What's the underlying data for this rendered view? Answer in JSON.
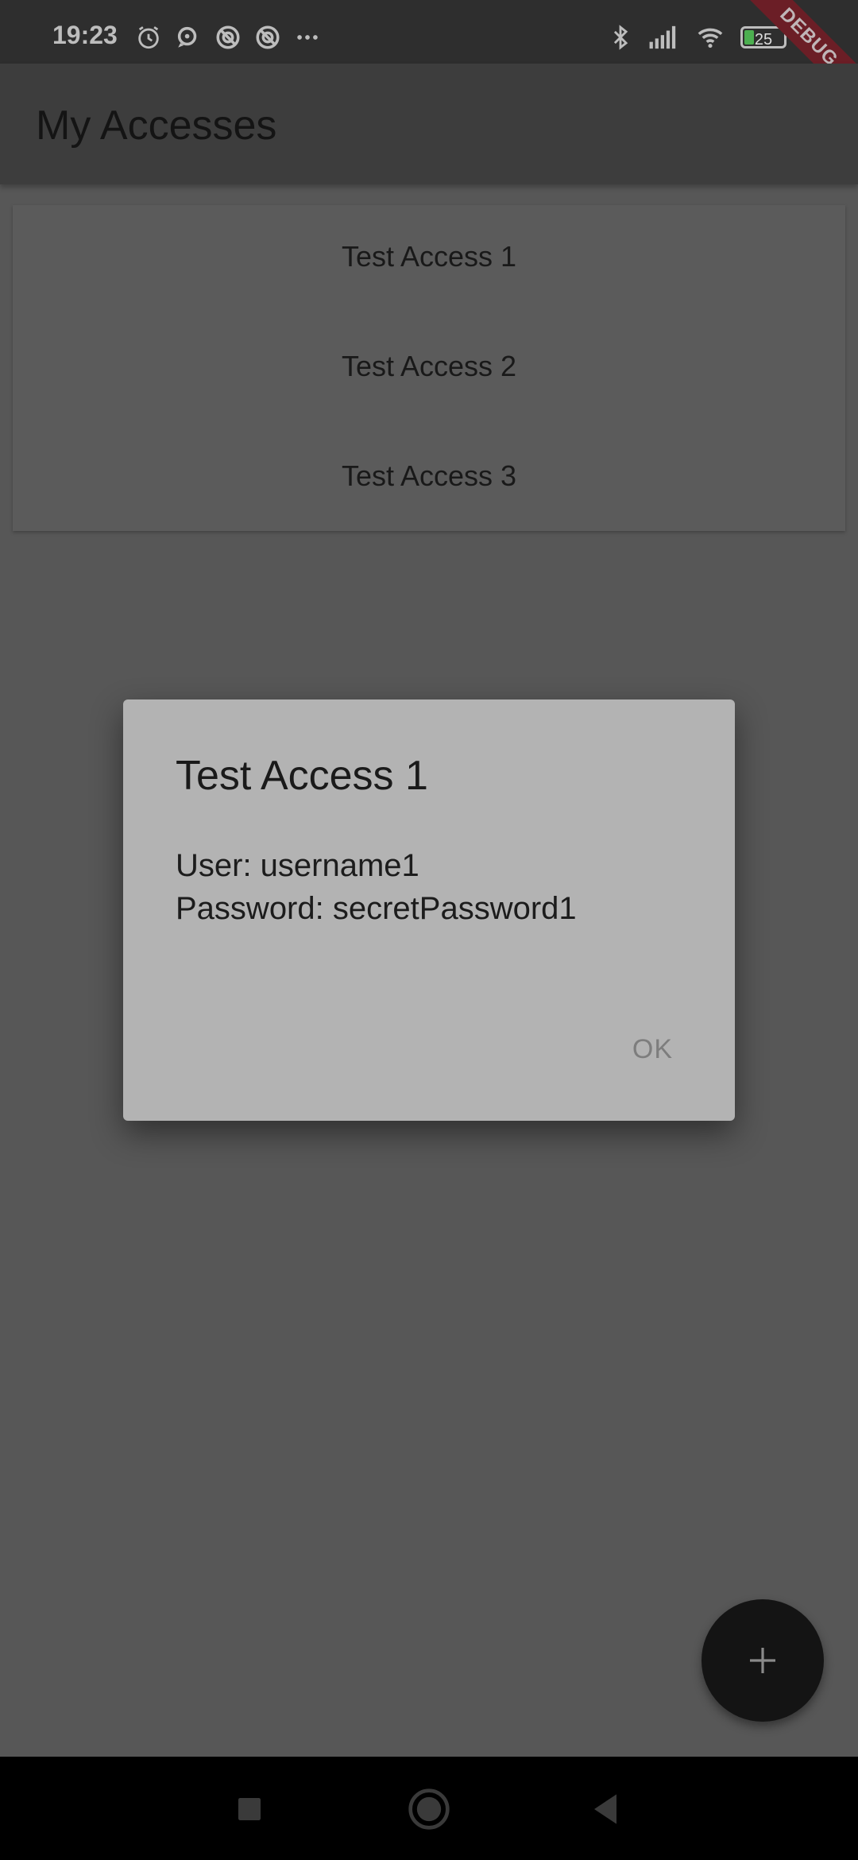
{
  "status_bar": {
    "time": "19:23",
    "battery_level": "25",
    "icons_left": [
      "alarm-icon",
      "chat-icon",
      "app-notification-icon",
      "app-notification-icon",
      "more-notifications-icon"
    ],
    "icons_right": [
      "bluetooth-icon",
      "signal-icon",
      "wifi-icon",
      "battery-icon"
    ]
  },
  "debug_banner": "DEBUG",
  "app_bar": {
    "title": "My Accesses"
  },
  "accesses": {
    "items": [
      {
        "label": "Test Access 1"
      },
      {
        "label": "Test Access 2"
      },
      {
        "label": "Test Access 3"
      }
    ]
  },
  "dialog": {
    "title": "Test Access 1",
    "user_line": "User: username1",
    "password_line": "Password: secretPassword1",
    "ok_label": "OK"
  },
  "fab": {
    "icon": "plus-icon"
  },
  "nav_bar": {
    "icons": [
      "recents-square-icon",
      "home-circle-icon",
      "back-triangle-icon"
    ]
  },
  "colors": {
    "app_bar": "#3d3d3d",
    "background": "#575757",
    "dialog": "#b3b3b3",
    "fab": "#141414",
    "debug_banner": "#6b1e26"
  }
}
